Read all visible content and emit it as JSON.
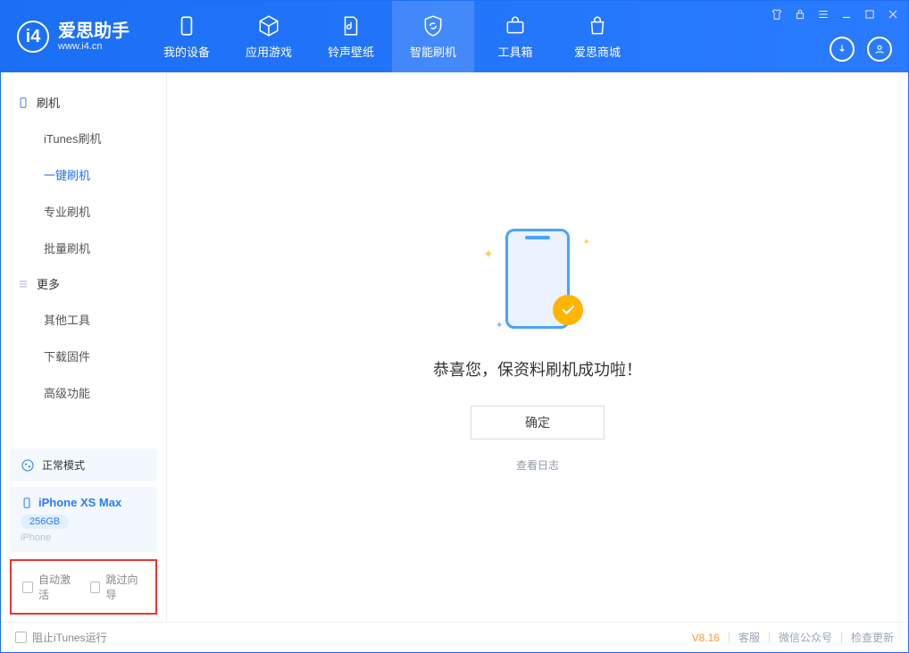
{
  "logo": {
    "name": "爱思助手",
    "url": "www.i4.cn"
  },
  "nav": [
    {
      "label": "我的设备"
    },
    {
      "label": "应用游戏"
    },
    {
      "label": "铃声壁纸"
    },
    {
      "label": "智能刷机"
    },
    {
      "label": "工具箱"
    },
    {
      "label": "爱思商城"
    }
  ],
  "sidebar": {
    "section1": "刷机",
    "items1": [
      "iTunes刷机",
      "一键刷机",
      "专业刷机",
      "批量刷机"
    ],
    "section2": "更多",
    "items2": [
      "其他工具",
      "下载固件",
      "高级功能"
    ]
  },
  "mode": {
    "label": "正常模式"
  },
  "device": {
    "name": "iPhone XS Max",
    "capacity": "256GB",
    "type": "iPhone"
  },
  "checkboxes": {
    "auto_activate": "自动激活",
    "skip_guide": "跳过向导"
  },
  "main": {
    "success_msg": "恭喜您，保资料刷机成功啦！",
    "ok": "确定",
    "view_log": "查看日志"
  },
  "footer": {
    "block_itunes": "阻止iTunes运行",
    "version": "V8.16",
    "links": [
      "客服",
      "微信公众号",
      "检查更新"
    ]
  }
}
